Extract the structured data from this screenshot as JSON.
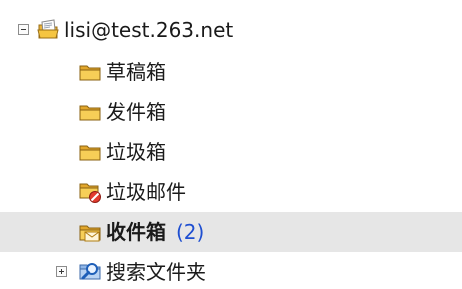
{
  "tree": {
    "account": {
      "label": "lisi@test.263.net",
      "expander": "collapse",
      "icon": "account-icon"
    },
    "folders": [
      {
        "label": "草稿箱",
        "icon": "folder-icon"
      },
      {
        "label": "发件箱",
        "icon": "folder-icon"
      },
      {
        "label": "垃圾箱",
        "icon": "folder-icon"
      },
      {
        "label": "垃圾邮件",
        "icon": "junk-mail-folder-icon"
      },
      {
        "label": "收件箱",
        "icon": "inbox-icon",
        "unread": "(2)",
        "selected": true
      }
    ],
    "search": {
      "label": "搜索文件夹",
      "expander": "expand",
      "icon": "search-folder-icon"
    }
  },
  "colors": {
    "selection": "#e6e6e6",
    "unread_count": "#1f4fd1",
    "folder": "#f5c542"
  }
}
